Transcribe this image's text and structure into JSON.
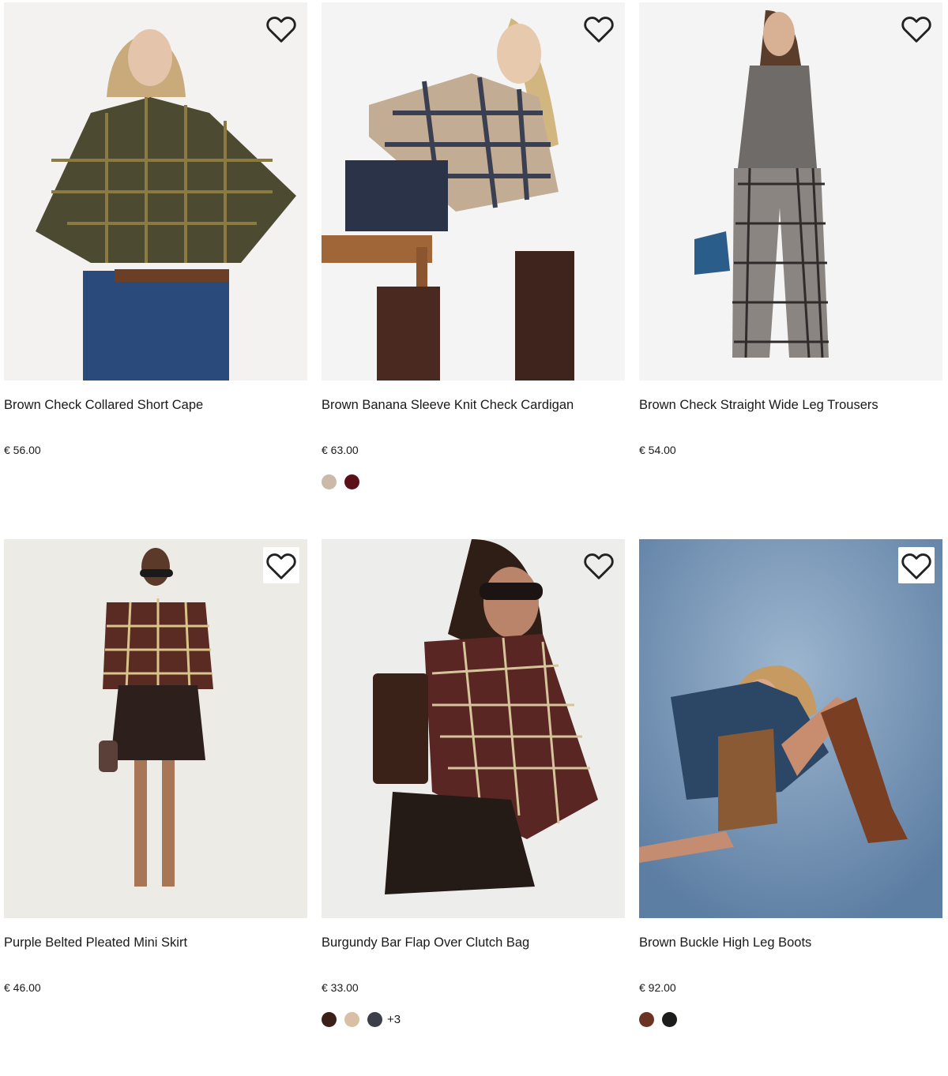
{
  "products": [
    {
      "name": "Brown Check Collared Short Cape",
      "price": "€ 56.00",
      "background": "#f3f2f0",
      "wishlist_boxed": false,
      "swatches": [],
      "more": ""
    },
    {
      "name": "Brown Banana Sleeve Knit Check Cardigan",
      "price": "€ 63.00",
      "background": "#f4f4f4",
      "wishlist_boxed": false,
      "swatches": [
        "#cbb9a9",
        "#5a1019"
      ],
      "more": ""
    },
    {
      "name": "Brown Check Straight Wide Leg Trousers",
      "price": "€ 54.00",
      "background": "#f4f4f4",
      "wishlist_boxed": false,
      "swatches": [],
      "more": ""
    },
    {
      "name": "Purple Belted Pleated Mini Skirt",
      "price": "€ 46.00",
      "background": "#ecebe6",
      "wishlist_boxed": true,
      "swatches": [],
      "more": ""
    },
    {
      "name": "Burgundy Bar Flap Over Clutch Bag",
      "price": "€ 33.00",
      "background": "#ededeb",
      "wishlist_boxed": false,
      "swatches": [
        "#3a2019",
        "#d9bfa3",
        "#3a3f4a"
      ],
      "more": "+3"
    },
    {
      "name": "Brown Buckle High Leg Boots",
      "price": "€ 92.00",
      "background": "#7a98b7",
      "wishlist_boxed": true,
      "swatches": [
        "#6b3422",
        "#1c1c1a"
      ],
      "more": ""
    }
  ],
  "icons": {
    "wishlist": "heart-outline-icon"
  }
}
